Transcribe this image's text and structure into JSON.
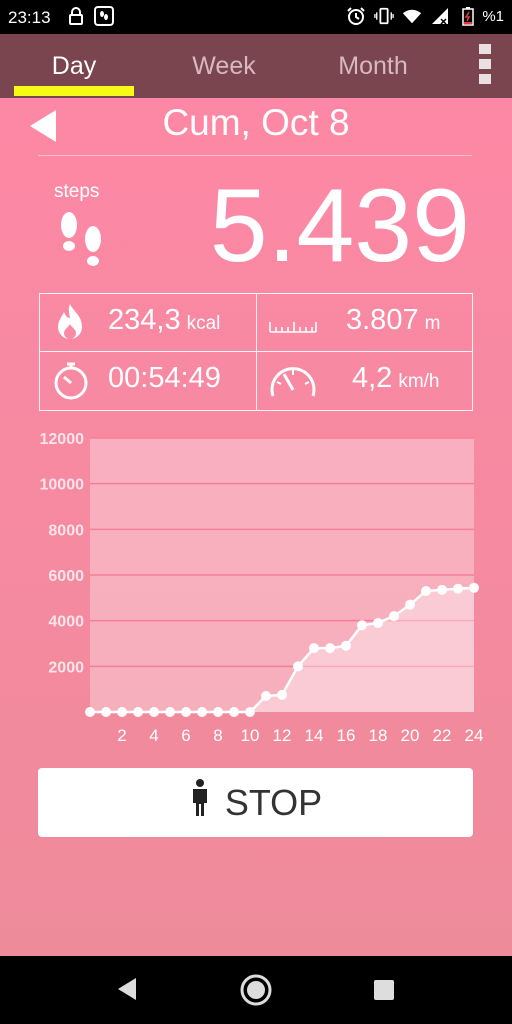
{
  "status_bar": {
    "time": "23:13",
    "battery_label": "%1",
    "icons": [
      "lock-icon",
      "step-app-icon",
      "alarm-icon",
      "vibrate-icon",
      "wifi-icon",
      "signal-icon",
      "battery-icon"
    ]
  },
  "tabs": [
    {
      "label": "Day",
      "active": true
    },
    {
      "label": "Week",
      "active": false
    },
    {
      "label": "Month",
      "active": false
    }
  ],
  "accent_color": "#f5fb16",
  "date": "Cum, Oct 8",
  "steps": {
    "label": "steps",
    "value": "5.439"
  },
  "stats": {
    "calories": {
      "value": "234,3",
      "unit": "kcal"
    },
    "distance": {
      "value": "3.807",
      "unit": "m"
    },
    "duration": {
      "value": "00:54:49"
    },
    "speed": {
      "value": "4,2",
      "unit": "km/h"
    }
  },
  "chart_data": {
    "type": "area",
    "x": [
      0,
      1,
      2,
      3,
      4,
      5,
      6,
      7,
      8,
      9,
      10,
      11,
      12,
      13,
      14,
      15,
      16,
      17,
      18,
      19,
      20,
      21,
      22,
      23,
      24
    ],
    "y_ticks": [
      2000,
      4000,
      6000,
      8000,
      10000,
      12000
    ],
    "x_ticks": [
      2,
      4,
      6,
      8,
      10,
      12,
      14,
      16,
      18,
      20,
      22,
      24
    ],
    "ylim": [
      0,
      12000
    ],
    "xlim": [
      0,
      24
    ],
    "series": [
      {
        "values": [
          0,
          0,
          0,
          0,
          0,
          0,
          0,
          0,
          0,
          0,
          0,
          700,
          750,
          2000,
          2800,
          2800,
          2900,
          3800,
          3900,
          4200,
          4700,
          5300,
          5350,
          5400,
          5439
        ]
      }
    ],
    "grid": true
  },
  "stop_button": {
    "label": "STOP"
  }
}
